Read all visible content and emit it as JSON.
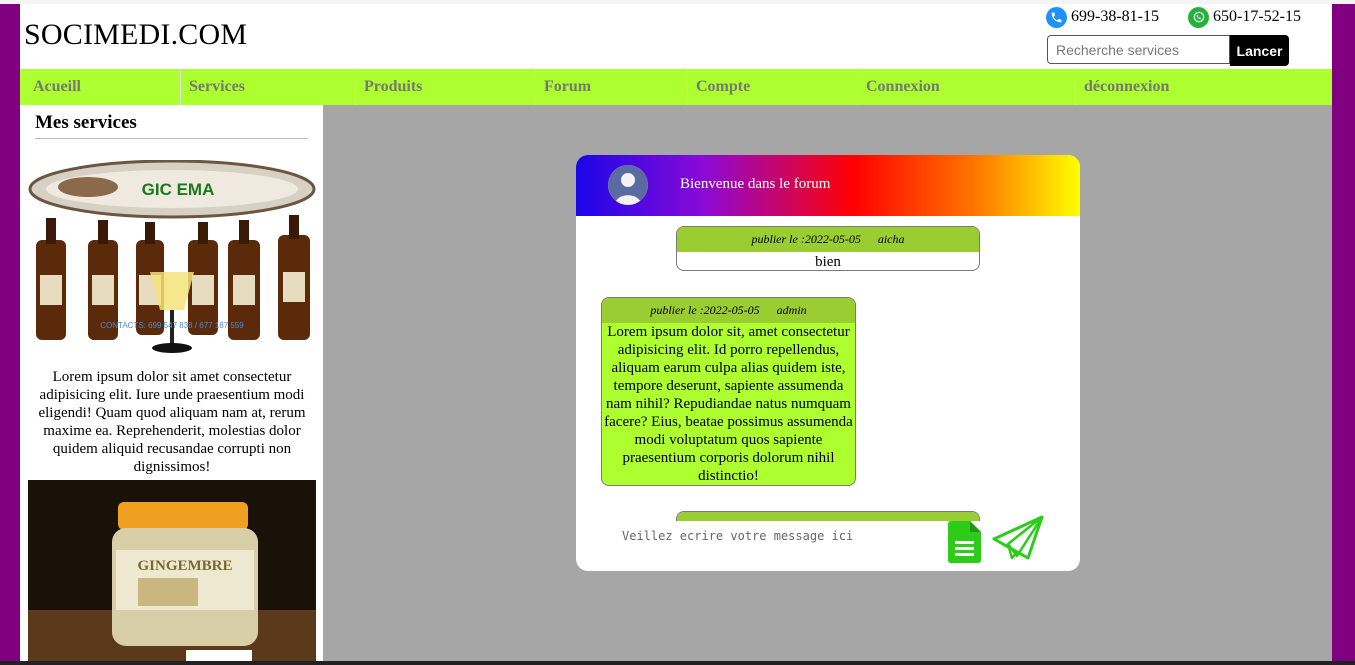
{
  "header": {
    "brand": "SOCIMEDI.COM",
    "phone": "699-38-81-15",
    "whatsapp": "650-17-52-15",
    "search_placeholder": "Recherche services",
    "search_button": "Lancer"
  },
  "nav": {
    "items": [
      "Acueill",
      "Services",
      "Produits",
      "Forum",
      "Compte",
      "Connexion",
      "déconnexion"
    ]
  },
  "sidebar": {
    "title": "Mes services",
    "image1_caption": "GIC EMA",
    "image1_contact": "CONTACTS: 699 547 838 / 677 187 559",
    "text": "Lorem ipsum dolor sit amet consectetur adipisicing elit. Iure unde praesentium modi eligendi! Quam quod aliquam nam at, rerum maxime ea. Reprehenderit, molestias dolor quidem aliquid recusandae corrupti non dignissimos!",
    "image2_caption": "GINGEMBRE"
  },
  "forum": {
    "title": "Bienvenue dans le forum",
    "messages": [
      {
        "date": "publier le :2022-05-05",
        "author": "aicha",
        "body": "bien"
      },
      {
        "date": "publier le :2022-05-05",
        "author": "admin",
        "body": "Lorem ipsum dolor sit, amet consectetur adipisicing elit. Id porro repellendus, aliquam earum culpa alias quidem iste, tempore deserunt, sapiente assumenda nam nihil? Repudiandae natus numquam facere? Eius, beatae possimus assumenda modi voluptatum quos sapiente praesentium corporis dolorum nihil distinctio!"
      }
    ],
    "composer_placeholder": "Veillez ecrire votre message ici"
  },
  "colors": {
    "frame": "#800080",
    "nav_bg": "#adff2f",
    "main_bg": "#a6a6a6",
    "msg_meta_bg": "#9acd32",
    "icon_green": "#2ecc1a"
  },
  "icons": [
    "phone-icon",
    "whatsapp-icon",
    "user-avatar-icon",
    "document-icon",
    "send-paper-plane-icon"
  ]
}
